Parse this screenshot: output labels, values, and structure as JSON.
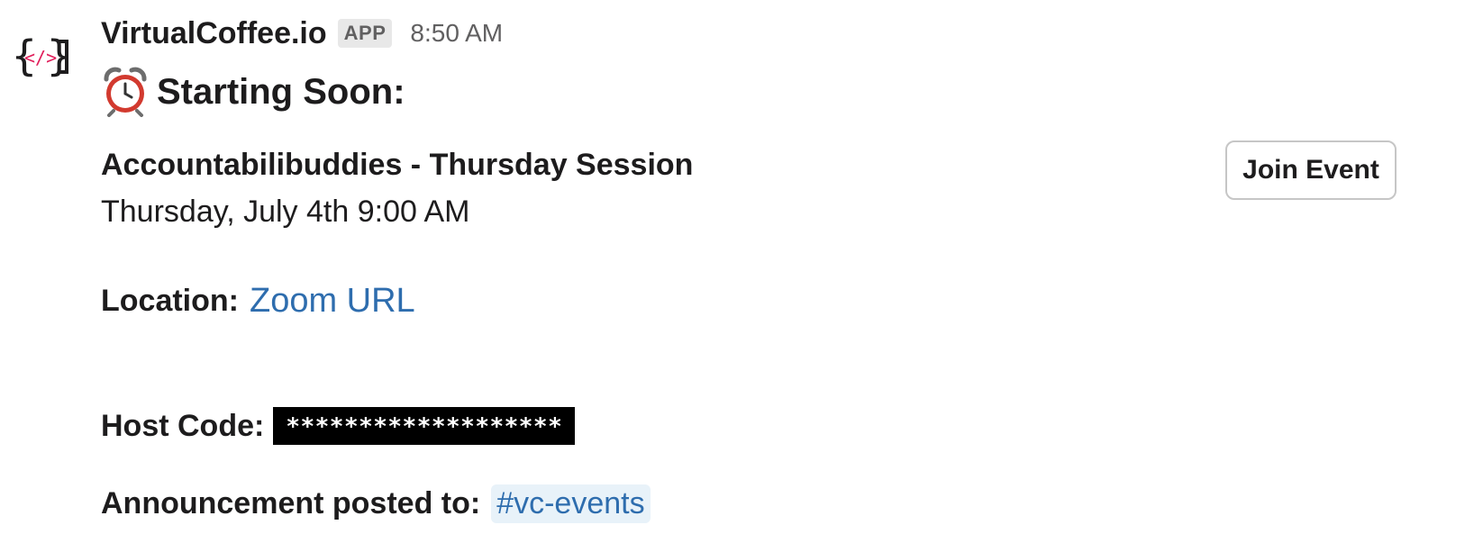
{
  "message": {
    "sender": "VirtualCoffee.io",
    "badge": "APP",
    "timestamp": "8:50 AM",
    "avatar_icon": "code-brackets-logo",
    "title": "Starting Soon:",
    "title_icon": "alarm-clock-icon",
    "event_name": "Accountabilibuddies - Thursday Session",
    "event_time": "Thursday, July 4th 9:00 AM",
    "location_label": "Location:",
    "location_link": "Zoom URL",
    "host_code_label": "Host Code:",
    "host_code_value": "*******************",
    "announcement_label": "Announcement posted to:",
    "channel": "#vc-events",
    "join_button": "Join Event"
  },
  "colors": {
    "link": "#2e6dae",
    "channel_bg": "#e8f2f9",
    "text": "#1d1c1d",
    "muted": "#616061",
    "spoiler_bg": "#000000",
    "logo_accent": "#e01e5a"
  }
}
